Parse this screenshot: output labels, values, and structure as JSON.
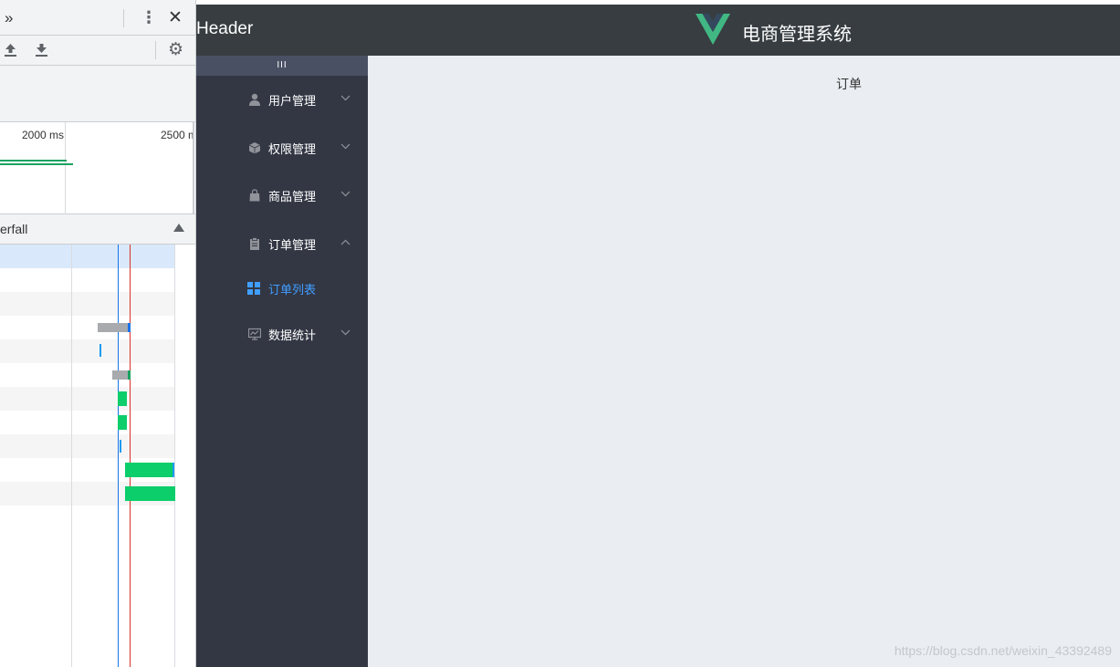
{
  "devtools": {
    "toolbar": {
      "more_tabs_icon": "double-chevron-right-icon",
      "menu_icon": "kebab-menu-icon",
      "close_icon": "close-icon",
      "import_icon": "upload-icon",
      "export_icon": "download-icon",
      "settings_icon": "gear-icon"
    },
    "overview": {
      "tick_2000": "2000 ms",
      "tick_2500": "2500 ms"
    },
    "waterfall": {
      "header_label": "erfall",
      "sort_icon": "sort-ascending-icon",
      "rows": 11
    }
  },
  "app": {
    "header_left": "Header",
    "title": "电商管理系统",
    "logo_icon": "vue-logo-icon",
    "collapse_label": "III",
    "menu": [
      {
        "label": "用户管理",
        "icon": "user-icon",
        "expanded": false
      },
      {
        "label": "权限管理",
        "icon": "cube-icon",
        "expanded": false
      },
      {
        "label": "商品管理",
        "icon": "shopping-bag-icon",
        "expanded": false
      },
      {
        "label": "订单管理",
        "icon": "clipboard-icon",
        "expanded": true,
        "children": [
          {
            "label": "订单列表",
            "icon": "grid-icon",
            "active": true
          }
        ]
      },
      {
        "label": "数据统计",
        "icon": "chart-icon",
        "expanded": false
      }
    ],
    "main_text": "订单",
    "watermark": "https://blog.csdn.net/weixin_43392489"
  },
  "colors": {
    "header_bg": "#373d41",
    "aside_bg": "#333744",
    "collapse_bg": "#4a5064",
    "main_bg": "#eaedf1",
    "active_menu": "#409eff",
    "vue_green": "#41b883",
    "vue_dark": "#35495e"
  }
}
